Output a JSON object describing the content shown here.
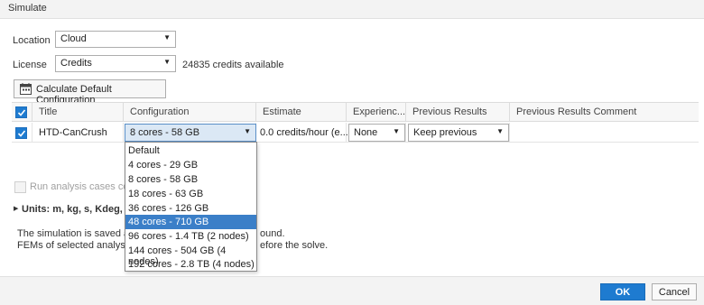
{
  "window": {
    "title": "Simulate"
  },
  "location": {
    "label": "Location",
    "value": "Cloud"
  },
  "license": {
    "label": "License",
    "value": "Credits",
    "credits_text": "24835 credits available"
  },
  "calc_button": {
    "label": "Calculate Default Configuration"
  },
  "table": {
    "headers": [
      "Title",
      "Configuration",
      "Estimate",
      "Experienc...",
      "Previous Results",
      "Previous Results Comment"
    ],
    "row": {
      "title": "HTD-CanCrush",
      "configuration": "8 cores - 58 GB",
      "estimate": "0.0 credits/hour (e...",
      "experience": "None",
      "previous_results": "Keep previous",
      "previous_results_comment": ""
    }
  },
  "dropdown": {
    "options": [
      "Default",
      "4 cores - 29 GB",
      "8 cores - 58 GB",
      "18 cores - 63 GB",
      "36 cores - 126 GB",
      "48 cores - 710 GB",
      "96 cores - 1.4 TB (2 nodes)",
      "144 cores - 504 GB (4 nodes)",
      "192 cores - 2.8 TB (4 nodes)"
    ],
    "selected": "48 cores - 710 GB"
  },
  "concurrent": {
    "label": "Run analysis cases conc",
    "checked": false
  },
  "units": {
    "text": "Units: m, kg, s, Kdeg, A, n"
  },
  "info": {
    "line1_left": "The simulation is saved auto",
    "line1_right": "ound.",
    "line2_left": "FEMs of selected analysis ca",
    "line2_right": "efore the solve."
  },
  "footer": {
    "ok": "OK",
    "cancel": "Cancel"
  },
  "colors": {
    "accent": "#1e7bd0",
    "selected_option": "#3b7fc8"
  }
}
